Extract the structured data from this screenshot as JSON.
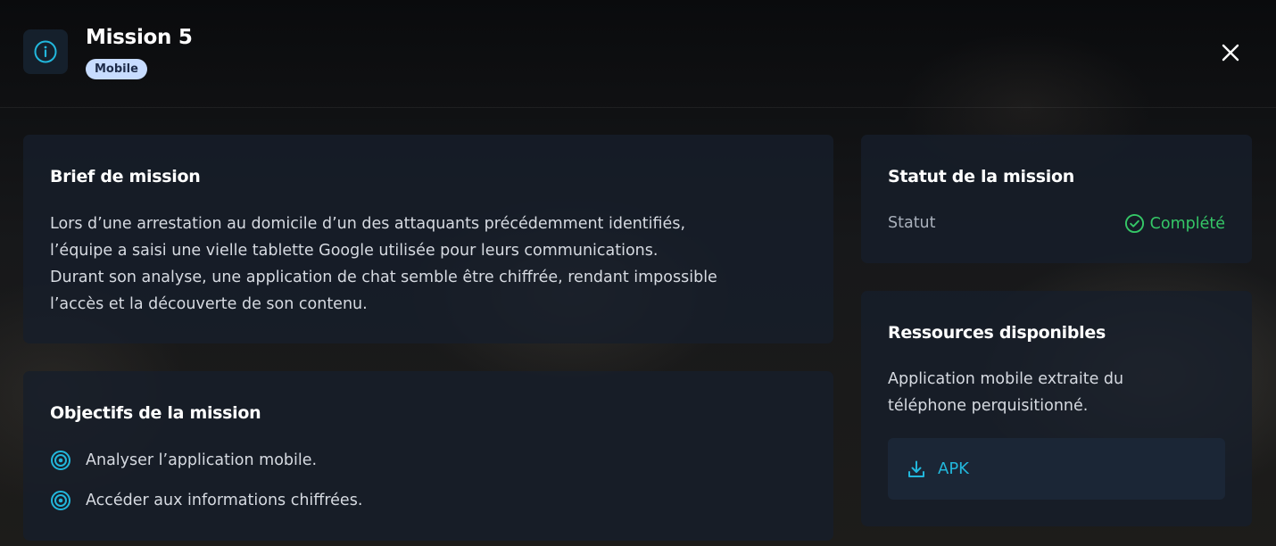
{
  "header": {
    "title": "Mission 5",
    "badge": "Mobile",
    "info_icon": "info-circle-icon",
    "close_icon": "close-icon"
  },
  "brief": {
    "title": "Brief de mission",
    "lines": [
      "Lors d’une arrestation au domicile d’un des attaquants précédemment identifiés,",
      "l’équipe a saisi une vielle tablette Google utilisée pour leurs communications.",
      "Durant son analyse, une application de chat semble être chiffrée, rendant impossible",
      "l’accès et la découverte de son contenu."
    ]
  },
  "objectives": {
    "title": "Objectifs de la mission",
    "items": [
      "Analyser l’application mobile.",
      "Accéder aux informations chiffrées."
    ],
    "item_icon": "target-icon"
  },
  "status": {
    "title": "Statut de la mission",
    "label": "Statut",
    "value": "Complété",
    "value_icon": "check-circle-icon"
  },
  "resources": {
    "title": "Ressources disponibles",
    "description_lines": [
      "Application mobile extraite du",
      "téléphone perquisitionné."
    ],
    "download_label": "APK",
    "download_icon": "download-icon"
  },
  "colors": {
    "accent": "#22b7dc",
    "success": "#35c767",
    "badge_bg": "#c7dcff",
    "card_bg": "#161e2a"
  }
}
